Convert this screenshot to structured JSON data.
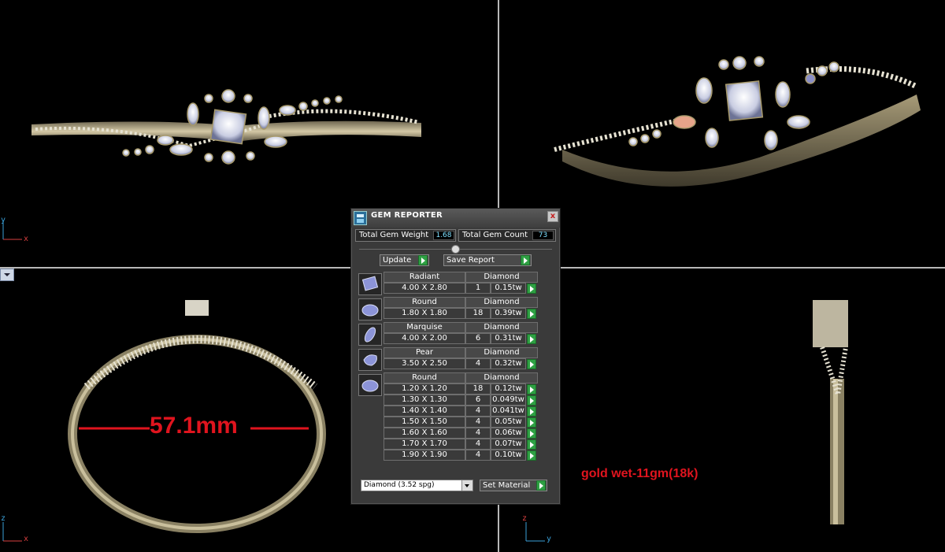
{
  "viewport": {
    "axes": {
      "top_left": [
        "y",
        "x"
      ],
      "bottom_left": [
        "z",
        "x"
      ],
      "bottom_right": [
        "z",
        "y"
      ]
    },
    "annotations": {
      "diameter": "57.1mm",
      "gold_weight": "gold wet-11gm(18k)"
    }
  },
  "gem_reporter": {
    "title": "GEM REPORTER",
    "close_label": "x",
    "total_gem_weight_label": "Total Gem Weight",
    "total_gem_weight": "1.68",
    "total_gem_count_label": "Total Gem Count",
    "total_gem_count": "73",
    "update_label": "Update",
    "save_report_label": "Save Report",
    "groups": [
      {
        "shape": "Radiant",
        "material": "Diamond",
        "icon": "radiant-gem-icon",
        "rows": [
          {
            "size": "4.00 X 2.80",
            "count": "1",
            "weight": "0.15tw"
          }
        ]
      },
      {
        "shape": "Round",
        "material": "Diamond",
        "icon": "round-gem-icon",
        "rows": [
          {
            "size": "1.80 X 1.80",
            "count": "18",
            "weight": "0.39tw"
          }
        ]
      },
      {
        "shape": "Marquise",
        "material": "Diamond",
        "icon": "marquise-gem-icon",
        "rows": [
          {
            "size": "4.00 X 2.00",
            "count": "6",
            "weight": "0.31tw"
          }
        ]
      },
      {
        "shape": "Pear",
        "material": "Diamond",
        "icon": "pear-gem-icon",
        "rows": [
          {
            "size": "3.50 X 2.50",
            "count": "4",
            "weight": "0.32tw"
          }
        ]
      },
      {
        "shape": "Round",
        "material": "Diamond",
        "icon": "round-gem-icon",
        "rows": [
          {
            "size": "1.20 X 1.20",
            "count": "18",
            "weight": "0.12tw"
          },
          {
            "size": "1.30 X 1.30",
            "count": "6",
            "weight": "0.049tw"
          },
          {
            "size": "1.40 X 1.40",
            "count": "4",
            "weight": "0.041tw"
          },
          {
            "size": "1.50 X 1.50",
            "count": "4",
            "weight": "0.05tw"
          },
          {
            "size": "1.60 X 1.60",
            "count": "4",
            "weight": "0.06tw"
          },
          {
            "size": "1.70 X 1.70",
            "count": "4",
            "weight": "0.07tw"
          },
          {
            "size": "1.90 X 1.90",
            "count": "4",
            "weight": "0.10tw"
          }
        ]
      }
    ],
    "material_select": "Diamond      (3.52 spg)",
    "set_material_label": "Set Material"
  },
  "colors": {
    "annotation_red": "#e0141e",
    "gold": "#b9ad8a",
    "go_green": "#2ea043"
  }
}
